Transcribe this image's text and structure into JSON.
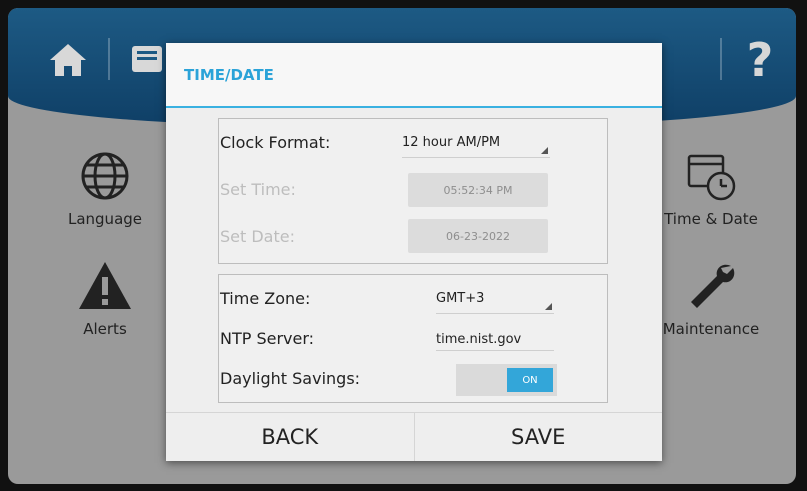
{
  "header": {
    "icons": [
      "home-icon",
      "display-icon",
      "folder-icon",
      "gear-icon",
      "gauge-icon",
      "tools-icon",
      "help-icon"
    ],
    "help_glyph": "?"
  },
  "side_menu": {
    "left": [
      {
        "label": "Language",
        "icon": "globe-icon"
      },
      {
        "label": "Alerts",
        "icon": "warning-icon"
      }
    ],
    "right": [
      {
        "label": "Time & Date",
        "icon": "calendar-clock-icon"
      },
      {
        "label": "Maintenance",
        "icon": "wrench-icon"
      }
    ]
  },
  "dialog": {
    "title": "TIME/DATE",
    "clock_format": {
      "label": "Clock Format:",
      "value": "12 hour AM/PM"
    },
    "set_time": {
      "label": "Set Time:",
      "value": "05:52:34 PM"
    },
    "set_date": {
      "label": "Set Date:",
      "value": "06-23-2022"
    },
    "time_zone": {
      "label": "Time Zone:",
      "value": "GMT+3"
    },
    "ntp_server": {
      "label": "NTP Server:",
      "value": "time.nist.gov"
    },
    "daylight_savings": {
      "label": "Daylight Savings:",
      "state": "ON"
    },
    "back_label": "BACK",
    "save_label": "SAVE"
  },
  "colors": {
    "accent": "#2ba3d8",
    "topbar": "#124a73",
    "toggle_on": "#33a6d9"
  }
}
